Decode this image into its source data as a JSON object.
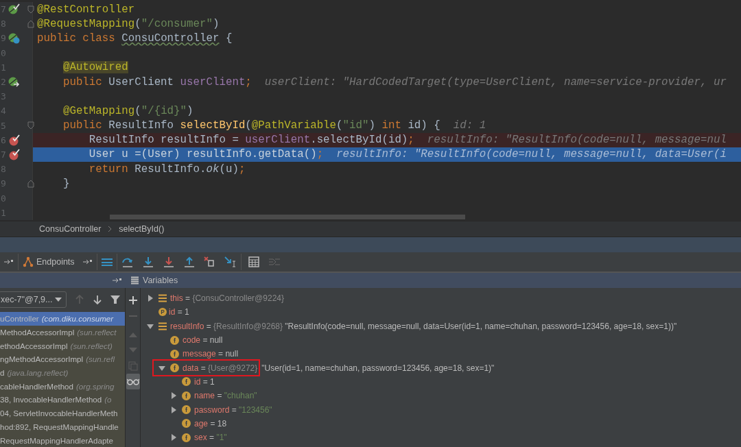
{
  "editor": {
    "lines": [
      {
        "number": "7",
        "gutter": [
          {
            "kind": "bean-check"
          },
          {
            "kind": "fold-start"
          }
        ],
        "breakpoint": false,
        "current": false,
        "tokens": [
          {
            "kind": "annotation",
            "text": "@RestController"
          }
        ]
      },
      {
        "number": "8",
        "gutter": [
          {
            "kind": "fold-end"
          }
        ],
        "breakpoint": false,
        "current": false,
        "tokens": [
          {
            "kind": "annotation",
            "text": "@RequestMapping"
          },
          {
            "kind": "plain",
            "text": "("
          },
          {
            "kind": "string",
            "text": "\"/consumer\""
          },
          {
            "kind": "plain",
            "text": ")"
          }
        ]
      },
      {
        "number": "9",
        "gutter": [
          {
            "kind": "bean-class"
          }
        ],
        "breakpoint": false,
        "current": false,
        "tokens": [
          {
            "kind": "keyword",
            "text": "public class "
          },
          {
            "kind": "warning",
            "text": "ConsuController"
          },
          {
            "kind": "plain",
            "text": " {"
          }
        ]
      },
      {
        "number": "0",
        "breakpoint": false,
        "current": false
      },
      {
        "number": "1",
        "breakpoint": false,
        "current": false,
        "tokens": [
          {
            "kind": "annotation-marked",
            "text": "    @Autowired"
          }
        ]
      },
      {
        "number": "2",
        "gutter": [
          {
            "kind": "bean-inject"
          }
        ],
        "breakpoint": false,
        "current": false,
        "tokens": [
          {
            "kind": "keyword",
            "text": "    public "
          },
          {
            "kind": "plain",
            "text": "UserClient "
          },
          {
            "kind": "field",
            "text": "userClient"
          },
          {
            "kind": "keyword",
            "text": ";"
          }
        ],
        "hint": "userClient: \"HardCodedTarget(type=UserClient, name=service-provider, ur"
      },
      {
        "number": "3",
        "breakpoint": false,
        "current": false
      },
      {
        "number": "4",
        "breakpoint": false,
        "current": false,
        "tokens": [
          {
            "kind": "annotation",
            "text": "    @GetMapping"
          },
          {
            "kind": "plain",
            "text": "("
          },
          {
            "kind": "string",
            "text": "\"/{id}\""
          },
          {
            "kind": "plain",
            "text": ")"
          }
        ]
      },
      {
        "number": "5",
        "gutter": [
          {
            "kind": "fold-start"
          }
        ],
        "breakpoint": false,
        "current": false,
        "tokens": [
          {
            "kind": "keyword",
            "text": "    public "
          },
          {
            "kind": "plain",
            "text": "ResultInfo "
          },
          {
            "kind": "method",
            "text": "selectById"
          },
          {
            "kind": "plain",
            "text": "("
          },
          {
            "kind": "annotation",
            "text": "@PathVariable"
          },
          {
            "kind": "plain",
            "text": "("
          },
          {
            "kind": "string",
            "text": "\"id\""
          },
          {
            "kind": "plain",
            "text": ") "
          },
          {
            "kind": "keyword",
            "text": "int "
          },
          {
            "kind": "plain",
            "text": "id) {"
          }
        ],
        "hint": "id: 1"
      },
      {
        "number": "6",
        "gutter": [
          {
            "kind": "breakpoint"
          }
        ],
        "breakpoint": true,
        "current": false,
        "tokens": [
          {
            "kind": "plain",
            "text": "        ResultInfo resultInfo = "
          },
          {
            "kind": "field",
            "text": "userClient"
          },
          {
            "kind": "plain",
            "text": ".selectById(id)"
          },
          {
            "kind": "keyword",
            "text": ";"
          }
        ],
        "hint": "resultInfo: \"ResultInfo(code=null, message=nul"
      },
      {
        "number": "7",
        "gutter": [
          {
            "kind": "breakpoint"
          }
        ],
        "breakpoint": true,
        "current": true,
        "tokens": [
          {
            "kind": "plain",
            "text": "        User u =(User) resultInfo.getData()"
          },
          {
            "kind": "keyword",
            "text": ";"
          }
        ],
        "hint": "resultInfo: \"ResultInfo(code=null, message=null, data=User(i"
      },
      {
        "number": "8",
        "breakpoint": false,
        "current": false,
        "tokens": [
          {
            "kind": "keyword",
            "text": "        return "
          },
          {
            "kind": "plain",
            "text": "ResultInfo."
          },
          {
            "kind": "static",
            "text": "ok"
          },
          {
            "kind": "plain",
            "text": "(u)"
          },
          {
            "kind": "keyword",
            "text": ";"
          }
        ]
      },
      {
        "number": "9",
        "gutter": [
          {
            "kind": "fold-end"
          }
        ],
        "breakpoint": false,
        "current": false,
        "tokens": [
          {
            "kind": "plain",
            "text": "    }"
          }
        ]
      },
      {
        "number": "0",
        "breakpoint": false,
        "current": false
      },
      {
        "number": "1",
        "breakpoint": false,
        "current": false
      }
    ]
  },
  "breadcrumbs": [
    "ConsuController",
    "selectById()"
  ],
  "debug_toolbar": {
    "endpoints_label": "Endpoints"
  },
  "frames": {
    "thread": "xec-7\"@7,9...",
    "up_disabled": true,
    "items": [
      {
        "name": "uController",
        "location": "(com.diku.consumer",
        "selected": true
      },
      {
        "name": "MethodAccessorImpl",
        "location": "(sun.reflect",
        "selected": false
      },
      {
        "name": "ethodAccessorImpl",
        "location": "(sun.reflect)",
        "selected": false
      },
      {
        "name": "ngMethodAccessorImpl",
        "location": "(sun.refl",
        "selected": false
      },
      {
        "name": "d",
        "location": "(java.lang.reflect)",
        "selected": false
      },
      {
        "name": "cableHandlerMethod",
        "location": "(org.spring",
        "selected": false
      },
      {
        "name": "38, InvocableHandlerMethod",
        "location": "(o",
        "selected": false
      },
      {
        "name": "04, ServletInvocableHandlerMeth",
        "selected": false
      },
      {
        "name": "hod:892, RequestMappingHandle",
        "selected": false
      },
      {
        "name": "RequestMappingHandlerAdapte",
        "selected": false
      }
    ]
  },
  "variables": {
    "title": "Variables",
    "nodes": [
      {
        "name": "this",
        "kind": "object",
        "operator": "=",
        "expanded": false,
        "type": "{ConsuController@9224}"
      },
      {
        "name": "id",
        "kind": "param",
        "operator": "=",
        "value": "1",
        "string": false
      },
      {
        "name": "resultInfo",
        "kind": "object",
        "operator": "=",
        "expanded": true,
        "type": "{ResultInfo@9268}",
        "summary": "\"ResultInfo(code=null, message=null, data=User(id=1, name=chuhan, password=123456, age=18, sex=1))\"",
        "children": [
          {
            "name": "code",
            "kind": "field",
            "operator": "=",
            "value": "null",
            "string": false
          },
          {
            "name": "message",
            "kind": "field",
            "operator": "=",
            "value": "null",
            "string": false
          },
          {
            "name": "data",
            "kind": "field",
            "operator": "=",
            "expanded": true,
            "boxed": true,
            "type": "{User@9272}",
            "summary": "\"User(id=1, name=chuhan, password=123456, age=18, sex=1)\"",
            "children": [
              {
                "name": "id",
                "kind": "field",
                "operator": "=",
                "value": "1",
                "string": false
              },
              {
                "name": "name",
                "kind": "field",
                "operator": "=",
                "expanded": false,
                "value": "\"chuhan\"",
                "string": true
              },
              {
                "name": "password",
                "kind": "field",
                "operator": "=",
                "expanded": false,
                "value": "\"123456\"",
                "string": true
              },
              {
                "name": "age",
                "kind": "field",
                "operator": "=",
                "value": "18",
                "string": false
              },
              {
                "name": "sex",
                "kind": "field",
                "operator": "=",
                "expanded": false,
                "value": "\"1\"",
                "string": true
              }
            ]
          }
        ]
      }
    ]
  }
}
